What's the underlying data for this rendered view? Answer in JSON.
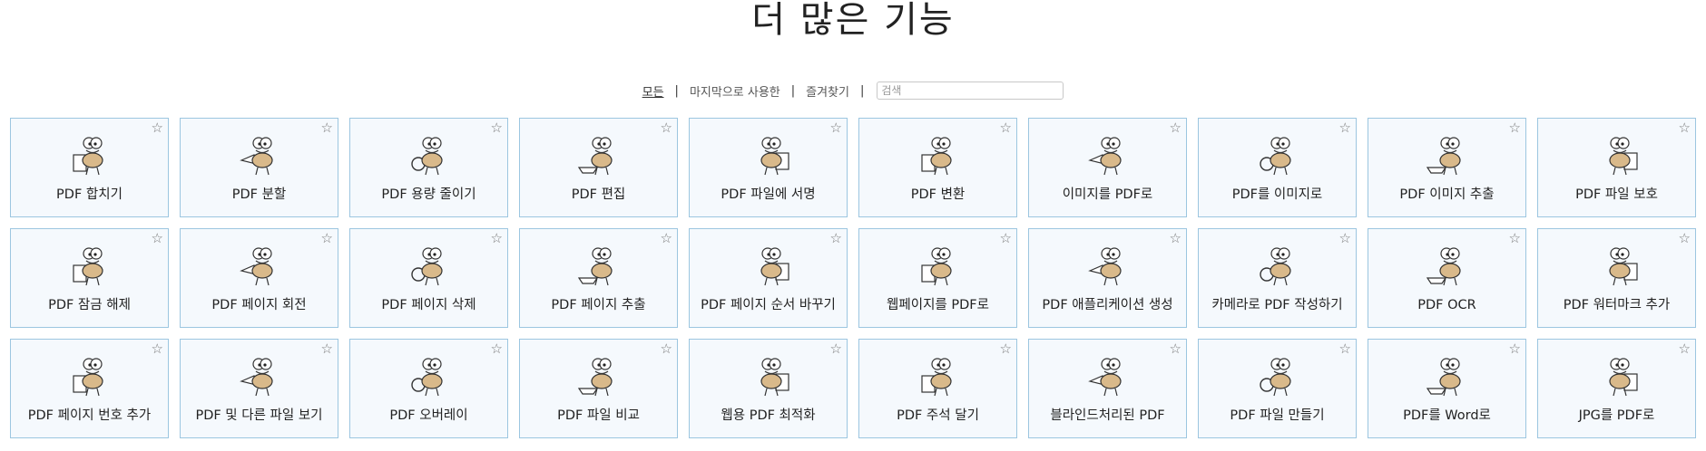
{
  "page": {
    "title": "더 많은 기능"
  },
  "filters": {
    "all": "모든",
    "recent": "마지막으로 사용한",
    "favorites": "즐겨찾기",
    "separator": "|",
    "search_placeholder": "검색"
  },
  "star_glyph": "☆",
  "colors": {
    "tile_bg": "#f5f9fd",
    "tile_border": "#9cc6e0",
    "mascot": "#d9b98a"
  },
  "tools": [
    {
      "label": "PDF 합치기",
      "icon": "merge-pdf-icon"
    },
    {
      "label": "PDF 분할",
      "icon": "split-pdf-icon"
    },
    {
      "label": "PDF 용량 줄이기",
      "icon": "compress-pdf-icon"
    },
    {
      "label": "PDF 편집",
      "icon": "edit-pdf-icon"
    },
    {
      "label": "PDF 파일에 서명",
      "icon": "sign-pdf-icon"
    },
    {
      "label": "PDF 변환",
      "icon": "convert-pdf-icon"
    },
    {
      "label": "이미지를 PDF로",
      "icon": "image-to-pdf-icon"
    },
    {
      "label": "PDF를 이미지로",
      "icon": "pdf-to-image-icon"
    },
    {
      "label": "PDF 이미지 추출",
      "icon": "extract-images-icon"
    },
    {
      "label": "PDF 파일 보호",
      "icon": "protect-pdf-icon"
    },
    {
      "label": "PDF 잠금 해제",
      "icon": "unlock-pdf-icon"
    },
    {
      "label": "PDF 페이지 회전",
      "icon": "rotate-pages-icon"
    },
    {
      "label": "PDF 페이지 삭제",
      "icon": "delete-pages-icon"
    },
    {
      "label": "PDF 페이지 추출",
      "icon": "extract-pages-icon"
    },
    {
      "label": "PDF 페이지 순서 바꾸기",
      "icon": "reorder-pages-icon"
    },
    {
      "label": "웹페이지를 PDF로",
      "icon": "webpage-to-pdf-icon"
    },
    {
      "label": "PDF 애플리케이션 생성",
      "icon": "create-pdf-app-icon"
    },
    {
      "label": "카메라로 PDF 작성하기",
      "icon": "camera-pdf-icon"
    },
    {
      "label": "PDF OCR",
      "icon": "ocr-icon"
    },
    {
      "label": "PDF 워터마크 추가",
      "icon": "watermark-icon"
    },
    {
      "label": "PDF 페이지 번호 추가",
      "icon": "page-numbers-icon"
    },
    {
      "label": "PDF 및 다른 파일 보기",
      "icon": "view-files-icon"
    },
    {
      "label": "PDF 오버레이",
      "icon": "overlay-icon"
    },
    {
      "label": "PDF 파일 비교",
      "icon": "compare-pdf-icon"
    },
    {
      "label": "웹용 PDF 최적화",
      "icon": "optimize-web-icon"
    },
    {
      "label": "PDF 주석 달기",
      "icon": "annotate-pdf-icon"
    },
    {
      "label": "블라인드처리된 PDF",
      "icon": "redact-pdf-icon"
    },
    {
      "label": "PDF 파일 만들기",
      "icon": "create-pdf-icon"
    },
    {
      "label": "PDF를 Word로",
      "icon": "pdf-to-word-icon"
    },
    {
      "label": "JPG를 PDF로",
      "icon": "jpg-to-pdf-icon"
    }
  ]
}
